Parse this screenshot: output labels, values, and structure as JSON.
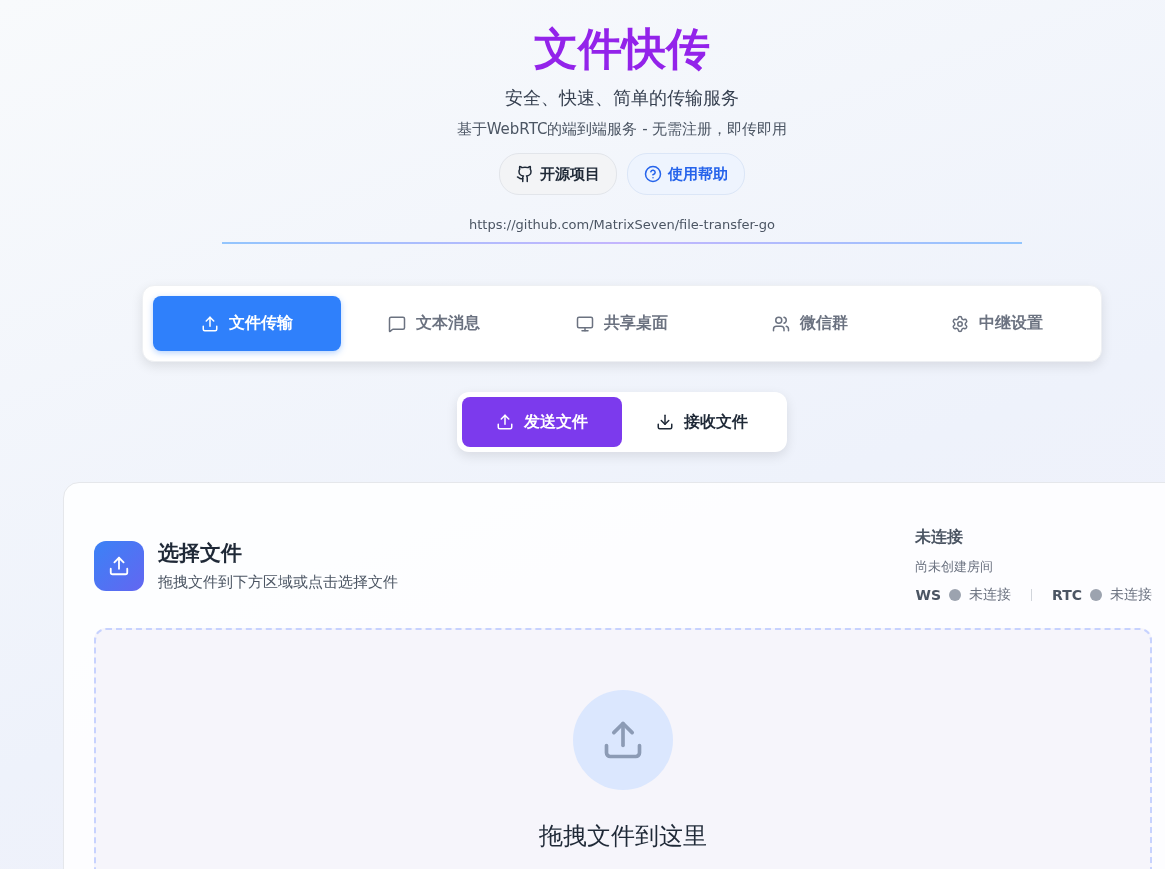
{
  "header": {
    "title": "文件快传",
    "subtitle": "安全、快速、简单的传输服务",
    "description": "基于WebRTC的端到端服务 - 无需注册，即传即用",
    "links": [
      {
        "kind": "github",
        "label": "开源项目"
      },
      {
        "kind": "help",
        "label": "使用帮助"
      }
    ],
    "repo_url": "https://github.com/MatrixSeven/file-transfer-go"
  },
  "tabs": [
    {
      "kind": "files",
      "label": "文件传输",
      "selected": true
    },
    {
      "kind": "text",
      "label": "文本消息",
      "selected": false
    },
    {
      "kind": "desktop",
      "label": "共享桌面",
      "selected": false
    },
    {
      "kind": "group",
      "label": "微信群",
      "selected": false
    },
    {
      "kind": "relay",
      "label": "中继设置",
      "selected": false
    }
  ],
  "modes": [
    {
      "kind": "send",
      "label": "发送文件",
      "selected": true
    },
    {
      "kind": "receive",
      "label": "接收文件",
      "selected": false
    }
  ],
  "panel": {
    "title": "选择文件",
    "subtitle": "拖拽文件到下方区域或点击选择文件",
    "status": {
      "title": "未连接",
      "room": "尚未创建房间",
      "channels": [
        {
          "name": "WS",
          "connected": false,
          "state": "未连接"
        },
        {
          "name": "RTC",
          "connected": false,
          "state": "未连接"
        }
      ]
    },
    "dropzone": {
      "title": "拖拽文件到这里"
    }
  }
}
